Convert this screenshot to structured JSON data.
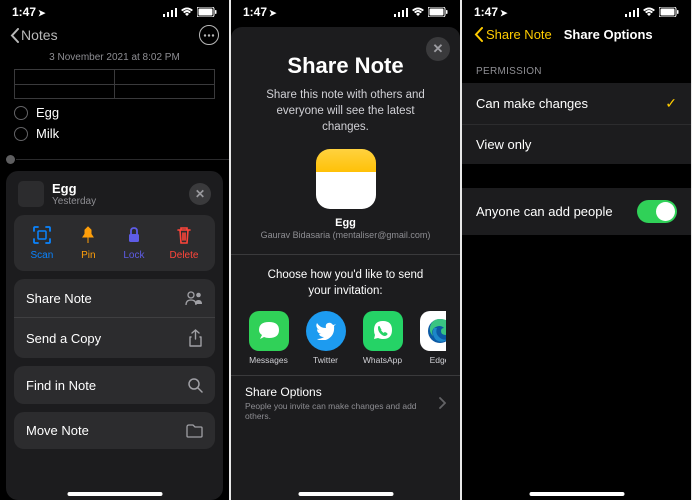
{
  "status": {
    "time": "1:47",
    "signal": "●●●●",
    "wifi": "wifi",
    "battery": "100"
  },
  "screen1": {
    "back_label": "Notes",
    "timestamp": "3 November 2021 at 8:02 PM",
    "checklist": [
      "Egg",
      "Milk"
    ],
    "sheet": {
      "title": "Egg",
      "subtitle": "Yesterday",
      "actions": {
        "scan": "Scan",
        "pin": "Pin",
        "lock": "Lock",
        "delete": "Delete"
      },
      "share_note": "Share Note",
      "send_copy": "Send a Copy",
      "find": "Find in Note",
      "move": "Move Note"
    }
  },
  "screen2": {
    "title": "Share Note",
    "description": "Share this note with others and everyone will see the latest changes.",
    "note_name": "Egg",
    "note_user": "Gaurav Bidasaria (mentaliser@gmail.com)",
    "choose": "Choose how you'd like to send your invitation:",
    "apps": {
      "messages": "Messages",
      "twitter": "Twitter",
      "whatsapp": "WhatsApp",
      "edge": "Edge"
    },
    "share_options_title": "Share Options",
    "share_options_sub": "People you invite can make changes and add others."
  },
  "screen3": {
    "back_label": "Share Note",
    "title": "Share Options",
    "permission_header": "PERMISSION",
    "can_make_changes": "Can make changes",
    "view_only": "View only",
    "anyone_add": "Anyone can add people"
  }
}
